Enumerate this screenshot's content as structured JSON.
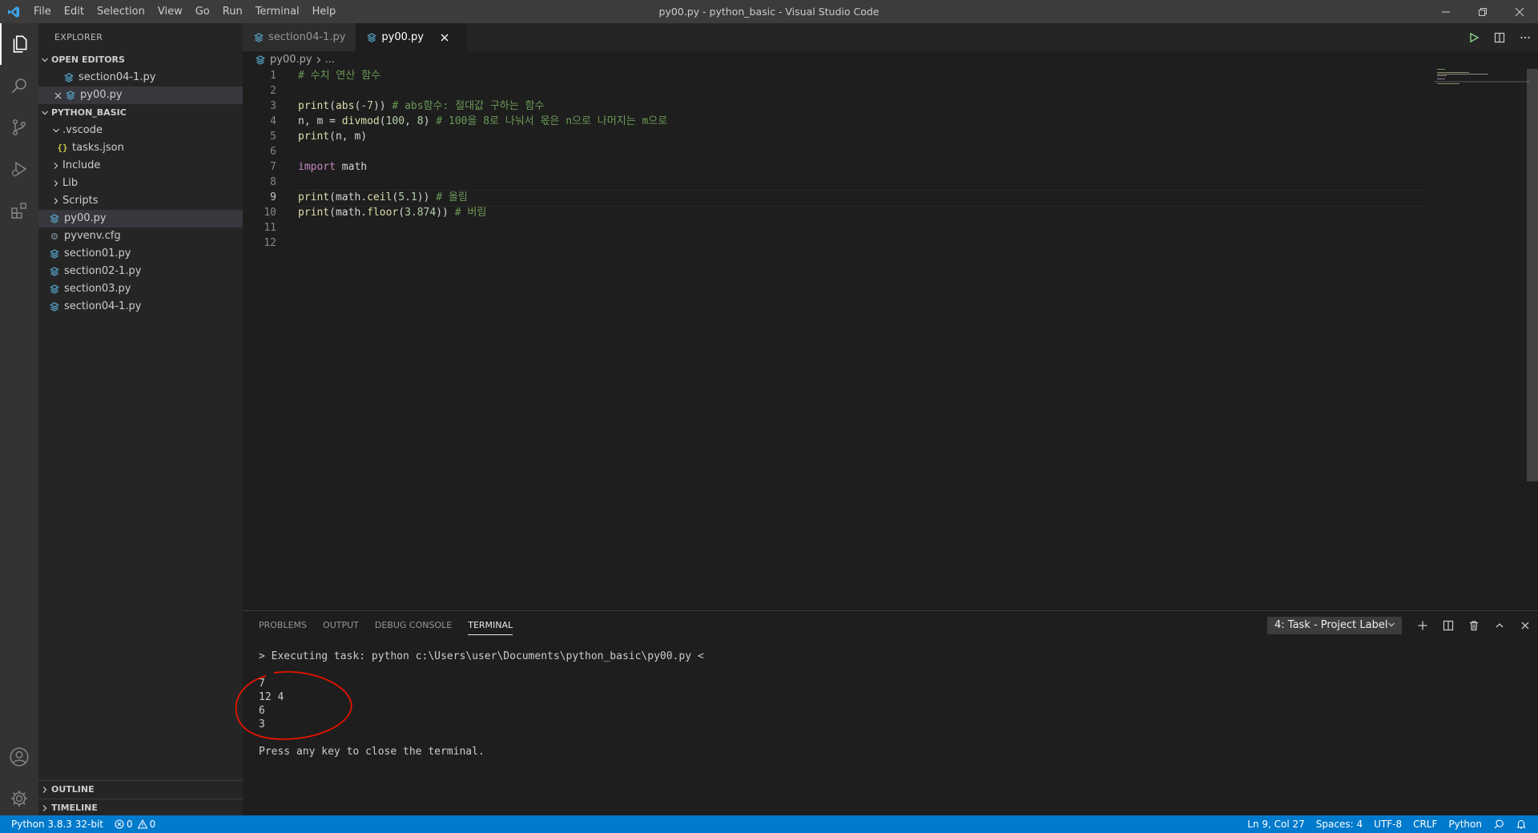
{
  "window": {
    "title": "py00.py - python_basic - Visual Studio Code",
    "menu": [
      "File",
      "Edit",
      "Selection",
      "View",
      "Go",
      "Run",
      "Terminal",
      "Help"
    ]
  },
  "colors": {
    "accent": "#007acc",
    "python_icon": "#519aba",
    "json_icon": "#cbcb41",
    "annotation": "#e51400",
    "run": "#89d185"
  },
  "activity_bar": {
    "top": [
      "files-icon",
      "search-icon",
      "source-control-icon",
      "run-debug-icon",
      "extensions-icon"
    ],
    "bottom": [
      "account-icon",
      "gear-icon"
    ]
  },
  "sidebar": {
    "title": "EXPLORER",
    "open_editors": {
      "label": "OPEN EDITORS",
      "items": [
        {
          "name": "section04-1.py"
        },
        {
          "name": "py00.py"
        }
      ]
    },
    "folder": {
      "label": "PYTHON_BASIC",
      "items": [
        {
          "name": ".vscode",
          "kind": "folder-open"
        },
        {
          "name": "tasks.json",
          "kind": "json"
        },
        {
          "name": "Include",
          "kind": "folder"
        },
        {
          "name": "Lib",
          "kind": "folder"
        },
        {
          "name": "Scripts",
          "kind": "folder"
        },
        {
          "name": "py00.py",
          "kind": "python"
        },
        {
          "name": "pyvenv.cfg",
          "kind": "config"
        },
        {
          "name": "section01.py",
          "kind": "python"
        },
        {
          "name": "section02-1.py",
          "kind": "python"
        },
        {
          "name": "section03.py",
          "kind": "python"
        },
        {
          "name": "section04-1.py",
          "kind": "python"
        }
      ]
    },
    "outline": "OUTLINE",
    "timeline": "TIMELINE"
  },
  "tabs": [
    {
      "label": "section04-1.py"
    },
    {
      "label": "py00.py"
    }
  ],
  "breadcrumb": {
    "file": "py00.py",
    "rest": "..."
  },
  "editor": {
    "lines": [
      {
        "n": "1",
        "text": "# 수치 연산 함수"
      },
      {
        "n": "2",
        "text": ""
      },
      {
        "n": "3",
        "text": "print(abs(-7)) # abs함수: 절대값 구하는 함수"
      },
      {
        "n": "4",
        "text": "n, m = divmod(100, 8) # 100을 8로 나눠서 몫은 n으로 나머지는 m으로"
      },
      {
        "n": "5",
        "text": "print(n, m)"
      },
      {
        "n": "6",
        "text": ""
      },
      {
        "n": "7",
        "text": "import math"
      },
      {
        "n": "8",
        "text": ""
      },
      {
        "n": "9",
        "text": "print(math.ceil(5.1)) # 올림"
      },
      {
        "n": "10",
        "text": "print(math.floor(3.874)) # 버림"
      },
      {
        "n": "11",
        "text": ""
      },
      {
        "n": "12",
        "text": ""
      }
    ]
  },
  "panel": {
    "tabs": [
      "PROBLEMS",
      "OUTPUT",
      "DEBUG CONSOLE",
      "TERMINAL"
    ],
    "terminal_select": "4: Task - Project Label",
    "terminal_lines": [
      "> Executing task: python c:\\Users\\user\\Documents\\python_basic\\py00.py <",
      "",
      "7",
      "12 4",
      "6",
      "3",
      "",
      "Press any key to close the terminal."
    ]
  },
  "status": {
    "interpreter": "Python 3.8.3 32-bit",
    "errors": "0",
    "warnings": "0",
    "position": "Ln 9, Col 27",
    "spaces": "Spaces: 4",
    "encoding": "UTF-8",
    "eol": "CRLF",
    "language": "Python"
  }
}
